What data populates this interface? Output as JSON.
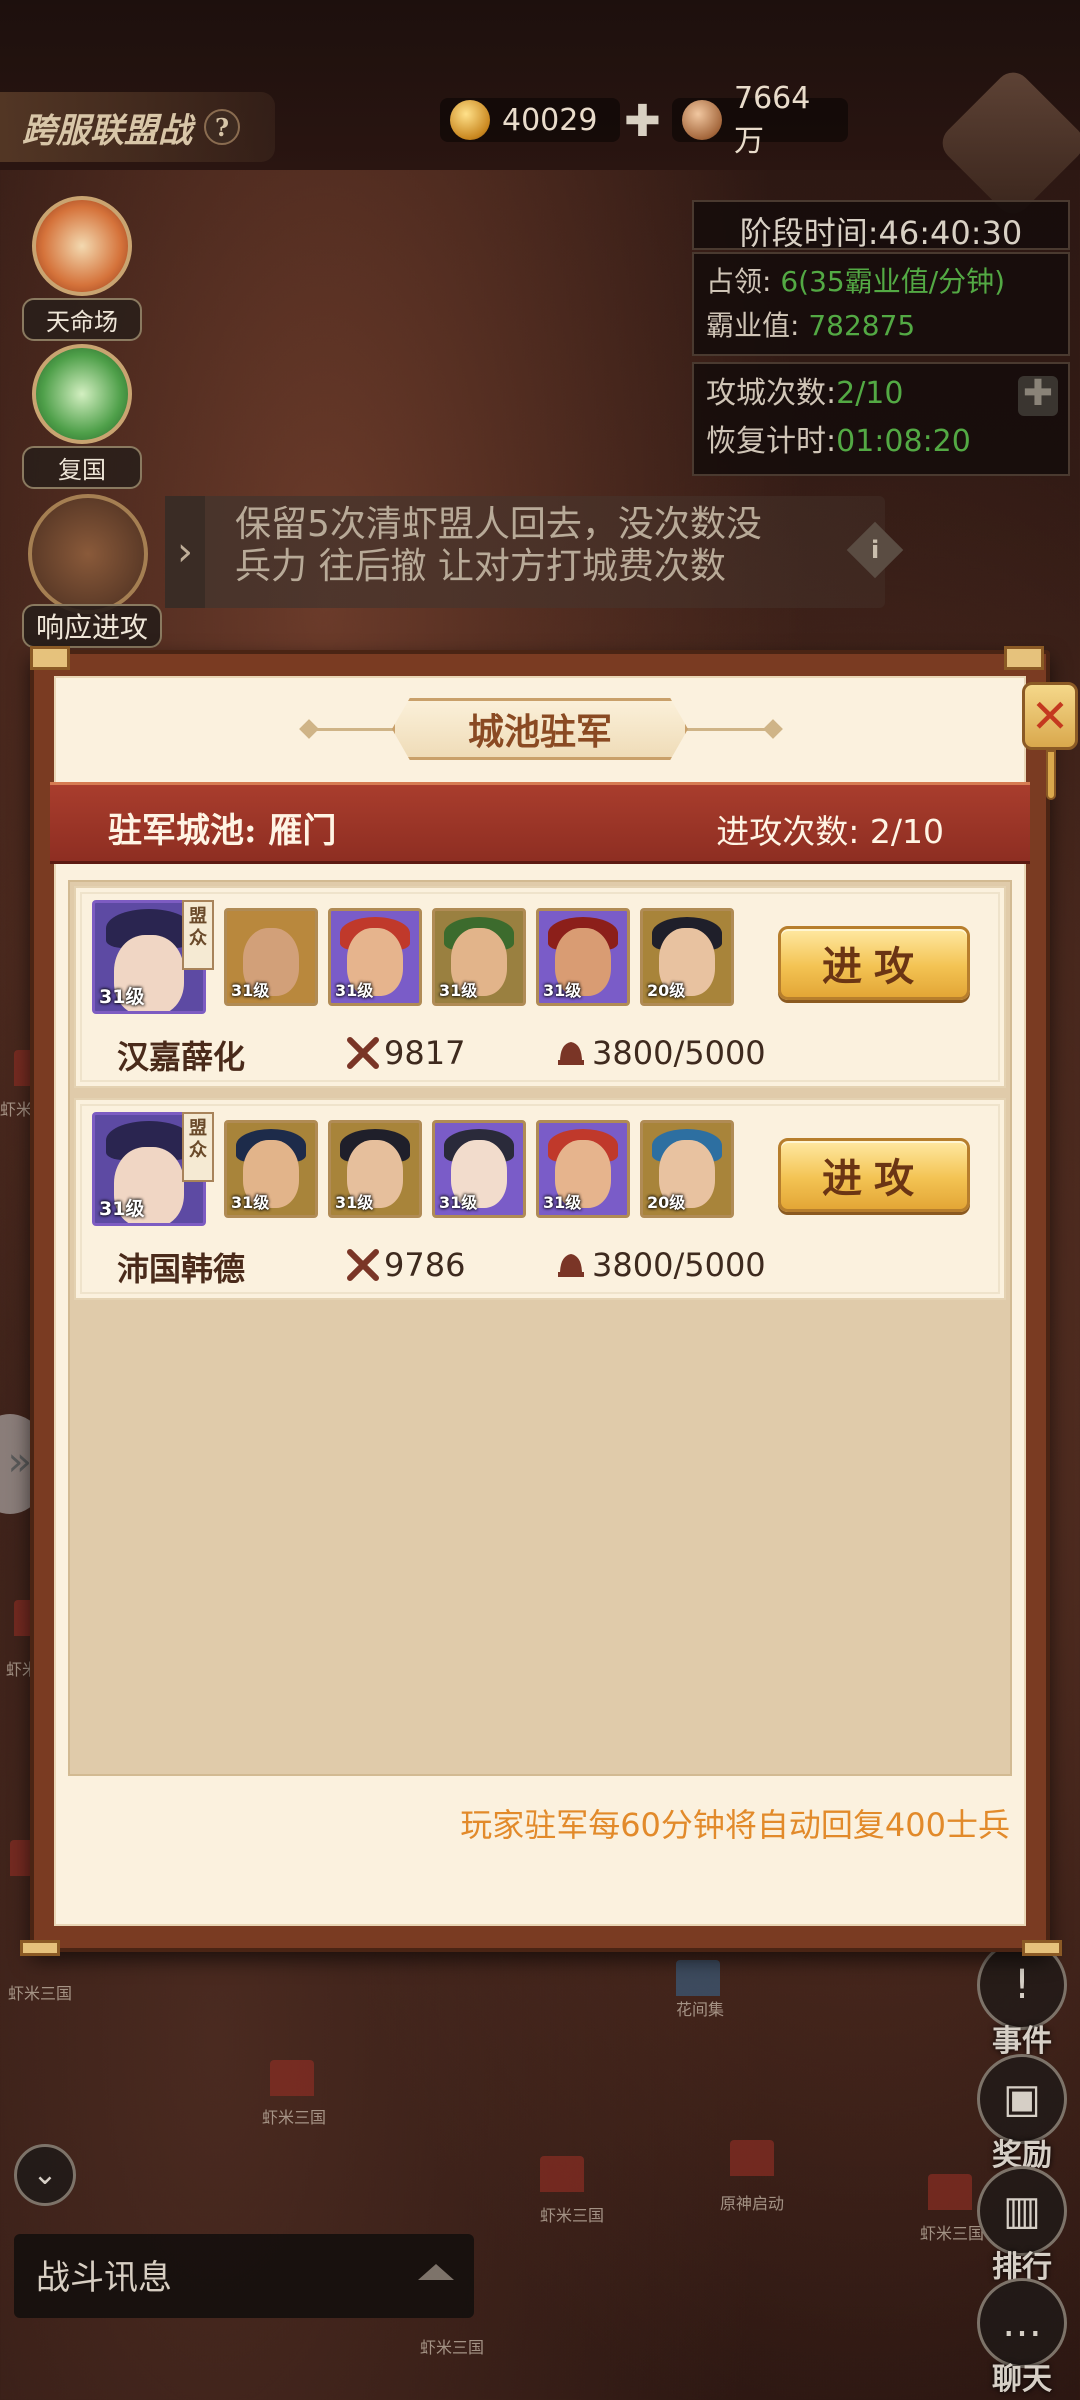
{
  "header": {
    "title": "跨服联盟战",
    "help": "?",
    "gold": "40029",
    "plus": "✚",
    "copper": "7664万"
  },
  "left_icons": [
    {
      "label": "天命场"
    },
    {
      "label": "复国"
    }
  ],
  "respond_label": "响应进攻",
  "info": {
    "phase_time": "阶段时间:46:40:30",
    "occupy_label": "占领:",
    "occupy_value": "6(35霸业值/分钟)",
    "score_label": "霸业值:",
    "score_value": "782875",
    "attack_count_label": "攻城次数:",
    "attack_count_value": "2/10",
    "recover_label": "恢复计时:",
    "recover_value": "01:08:20"
  },
  "notice": {
    "line1": "保留5次清虾盟人回去，没次数没",
    "line2": "兵力 往后撤 让对方打城费次数"
  },
  "dialog": {
    "title": "城池驻军",
    "city_label": "驻军城池: 雁门",
    "attack_times": "进攻次数: 2/10",
    "recovery_note": "玩家驻军每60分钟将自动回复400士兵",
    "attack_label": "进攻",
    "badge_text": "盟众",
    "rows": [
      {
        "player": "汉嘉薛化",
        "power": "9817",
        "troops": "3800/5000",
        "heroes": [
          {
            "level": "31级",
            "color": "#6b4fb3"
          },
          {
            "level": "31级",
            "color": "#b9883d"
          },
          {
            "level": "31级",
            "color": "#7a5cc8"
          },
          {
            "level": "31级",
            "color": "#9a8040"
          },
          {
            "level": "31级",
            "color": "#7a5cc8"
          },
          {
            "level": "20级",
            "color": "#a8843a"
          }
        ]
      },
      {
        "player": "沛国韩德",
        "power": "9786",
        "troops": "3800/5000",
        "heroes": [
          {
            "level": "31级",
            "color": "#6b4fb3"
          },
          {
            "level": "31级",
            "color": "#a8843a"
          },
          {
            "level": "31级",
            "color": "#a8843a"
          },
          {
            "level": "31级",
            "color": "#7a5cc8"
          },
          {
            "level": "31级",
            "color": "#7a5cc8"
          },
          {
            "level": "20级",
            "color": "#a8843a"
          }
        ]
      }
    ]
  },
  "right_nav": [
    {
      "label": "事件",
      "icon": "event-icon"
    },
    {
      "label": "奖励",
      "icon": "gift-icon"
    },
    {
      "label": "排行",
      "icon": "rank-icon"
    },
    {
      "label": "聊天",
      "icon": "chat-icon"
    }
  ],
  "battle_info": "战斗讯息",
  "map_labels": [
    "虾米三国",
    "虾米三国",
    "虾米三国",
    "花间集",
    "虾米三国",
    "原神启动",
    "虾米三国",
    "虾米三国",
    "虾米三国"
  ],
  "colors": {
    "accent_red": "#a93d2d",
    "button_gold": "#f3c353",
    "note_orange": "#e28a2a",
    "info_green": "#53a944"
  }
}
